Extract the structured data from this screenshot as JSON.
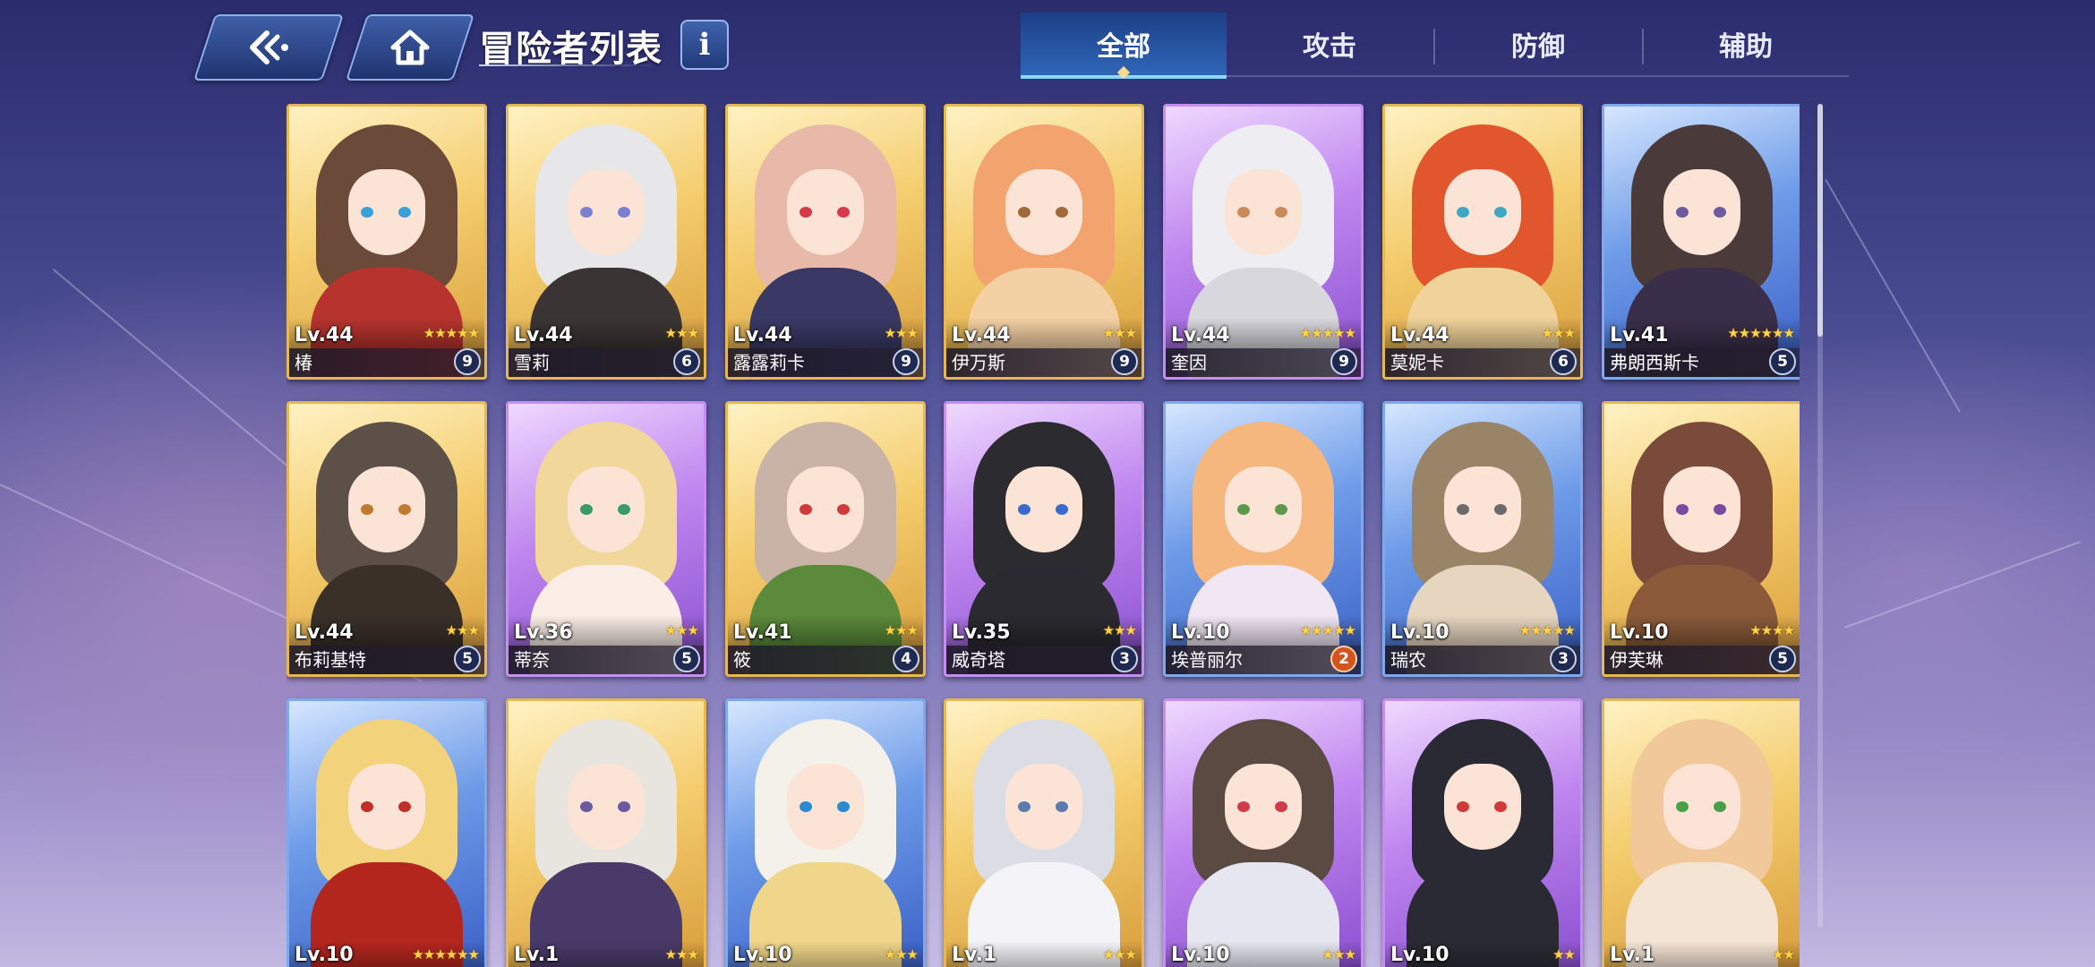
{
  "header": {
    "back_icon": "back-arrow-icon",
    "home_icon": "home-icon",
    "title": "冒险者列表",
    "info_label": "i"
  },
  "tabs": [
    {
      "label": "全部",
      "active": true
    },
    {
      "label": "攻击",
      "active": false
    },
    {
      "label": "防御",
      "active": false
    },
    {
      "label": "辅助",
      "active": false
    }
  ],
  "cards": [
    {
      "name": "椿",
      "level": "Lv.44",
      "stars": 5,
      "badge": "9",
      "frame": "gold",
      "hair": "#6b4a3a",
      "eyes": "#3aa0d8",
      "outfit": "#b7342e"
    },
    {
      "name": "雪莉",
      "level": "Lv.44",
      "stars": 3,
      "badge": "6",
      "frame": "gold",
      "hair": "#e7e7ea",
      "eyes": "#7a7fd0",
      "outfit": "#3b3434"
    },
    {
      "name": "露露莉卡",
      "level": "Lv.44",
      "stars": 3,
      "badge": "9",
      "frame": "gold",
      "hair": "#e8b9a9",
      "eyes": "#d63a4a",
      "outfit": "#3a3966"
    },
    {
      "name": "伊万斯",
      "level": "Lv.44",
      "stars": 3,
      "badge": "9",
      "frame": "gold",
      "hair": "#f3a36e",
      "eyes": "#a06a3a",
      "outfit": "#f4d1a4"
    },
    {
      "name": "奎因",
      "level": "Lv.44",
      "stars": 5,
      "badge": "9",
      "frame": "purple",
      "hair": "#eeeef2",
      "eyes": "#c98a5a",
      "outfit": "#d7d7dd"
    },
    {
      "name": "莫妮卡",
      "level": "Lv.44",
      "stars": 3,
      "badge": "6",
      "frame": "gold",
      "hair": "#e2562e",
      "eyes": "#3fa8c0",
      "outfit": "#f0d39a"
    },
    {
      "name": "弗朗西斯卡",
      "level": "Lv.41",
      "stars": 6,
      "badge": "5",
      "frame": "blue",
      "hair": "#4b3a3a",
      "eyes": "#6d5aa0",
      "outfit": "#3a2f4a"
    },
    {
      "name": "布莉基特",
      "level": "Lv.44",
      "stars": 3,
      "badge": "5",
      "frame": "gold",
      "hair": "#5c5048",
      "eyes": "#c07a30",
      "outfit": "#3a3028"
    },
    {
      "name": "蒂奈",
      "level": "Lv.36",
      "stars": 3,
      "badge": "5",
      "frame": "purple",
      "hair": "#f2d79a",
      "eyes": "#3a9a6a",
      "outfit": "#fbeee6"
    },
    {
      "name": "筱",
      "level": "Lv.41",
      "stars": 3,
      "badge": "4",
      "frame": "gold",
      "hair": "#c9b3a7",
      "eyes": "#d03a3a",
      "outfit": "#5a8a3a"
    },
    {
      "name": "威奇塔",
      "level": "Lv.35",
      "stars": 3,
      "badge": "3",
      "frame": "purple",
      "hair": "#2b2b30",
      "eyes": "#3a6ad0",
      "outfit": "#2a2a30"
    },
    {
      "name": "埃普丽尔",
      "level": "Lv.10",
      "stars": 5,
      "badge": "2",
      "frame": "blue",
      "hair": "#f5b77e",
      "eyes": "#5a9a4a",
      "outfit": "#f0e6f4",
      "badge_style": "orange"
    },
    {
      "name": "瑞农",
      "level": "Lv.10",
      "stars": 5,
      "badge": "3",
      "frame": "blue",
      "hair": "#9a8468",
      "eyes": "#6a6a6a",
      "outfit": "#e6d6c0"
    },
    {
      "name": "伊芙琳",
      "level": "Lv.10",
      "stars": 4,
      "badge": "5",
      "frame": "gold",
      "hair": "#7a4a3a",
      "eyes": "#7a4aa0",
      "outfit": "#8a5a3a"
    },
    {
      "name": "",
      "level": "Lv.10",
      "stars": 6,
      "badge": "",
      "frame": "blue",
      "hair": "#f2d27a",
      "eyes": "#c0302a",
      "outfit": "#b3261e"
    },
    {
      "name": "",
      "level": "Lv.1",
      "stars": 3,
      "badge": "",
      "frame": "gold",
      "hair": "#e8e4de",
      "eyes": "#6a5aa0",
      "outfit": "#4a3a6a"
    },
    {
      "name": "",
      "level": "Lv.10",
      "stars": 3,
      "badge": "",
      "frame": "blue",
      "hair": "#f4f0ea",
      "eyes": "#2a8ad0",
      "outfit": "#f0d68a"
    },
    {
      "name": "",
      "level": "Lv.1",
      "stars": 3,
      "badge": "",
      "frame": "gold",
      "hair": "#dcdde4",
      "eyes": "#5a7ab0",
      "outfit": "#f4f4f8"
    },
    {
      "name": "",
      "level": "Lv.10",
      "stars": 3,
      "badge": "",
      "frame": "purple",
      "hair": "#5a4a42",
      "eyes": "#d03a4a",
      "outfit": "#e6e6f0"
    },
    {
      "name": "",
      "level": "Lv.10",
      "stars": 2,
      "badge": "",
      "frame": "purple",
      "hair": "#2a2a34",
      "eyes": "#d03a3a",
      "outfit": "#2a2a34"
    },
    {
      "name": "",
      "level": "Lv.1",
      "stars": 2,
      "badge": "",
      "frame": "gold",
      "hair": "#f0c89a",
      "eyes": "#4aa04a",
      "outfit": "#f4e4d4"
    }
  ]
}
